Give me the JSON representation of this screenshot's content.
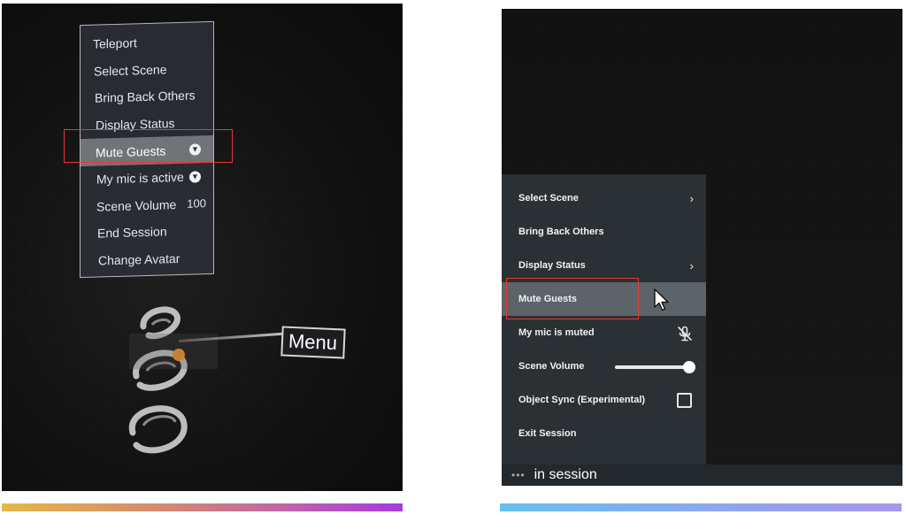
{
  "vr_view": {
    "menu_items": [
      {
        "label": "Teleport"
      },
      {
        "label": "Select Scene"
      },
      {
        "label": "Bring Back Others"
      },
      {
        "label": "Display Status"
      },
      {
        "label": "Mute Guests",
        "highlighted": true,
        "icon": "mic-badge-icon"
      },
      {
        "label": "My mic is active",
        "icon": "mic-badge-icon"
      },
      {
        "label": "Scene Volume",
        "value": "100"
      },
      {
        "label": "End Session"
      },
      {
        "label": "Change Avatar"
      }
    ],
    "pointer_tag": "Menu",
    "pointer_dot_color": "#c8822f",
    "highlight_box_color": "#e53935"
  },
  "desktop_view": {
    "menu_items": [
      {
        "label": "Select Scene",
        "control": "chevron-right-icon"
      },
      {
        "label": "Bring Back Others"
      },
      {
        "label": "Display Status",
        "control": "chevron-right-icon"
      },
      {
        "label": "Mute Guests",
        "highlighted": true
      },
      {
        "label": "My mic is muted",
        "control": "mic-off-icon"
      },
      {
        "label": "Scene Volume",
        "control": "slider",
        "level": 1.0
      },
      {
        "label": "Object Sync (Experimental)",
        "control": "checkbox",
        "checked": false
      },
      {
        "label": "Exit Session"
      }
    ],
    "chevron_glyph": "›",
    "status": {
      "dots": "•••",
      "text": "in session"
    },
    "highlight_box_color": "#e53935"
  },
  "accent_bars": {
    "left": [
      "#e5b845",
      "#a63be0"
    ],
    "right": [
      "#68bfee",
      "#a897ec"
    ]
  }
}
